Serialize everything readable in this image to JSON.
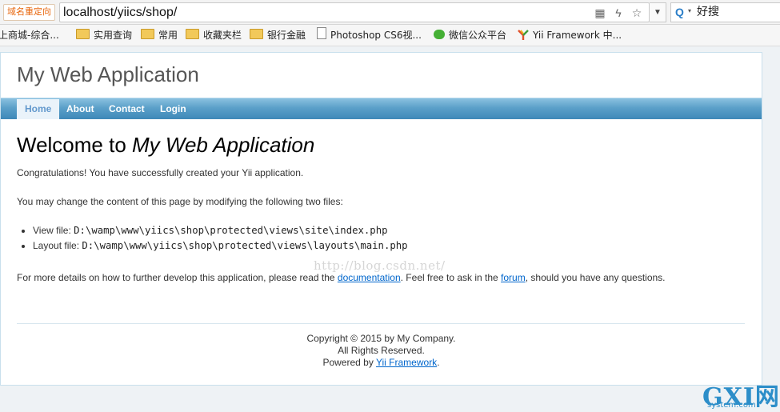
{
  "browser": {
    "redirect_label": "域名重定向",
    "url": "localhost/yiics/shop/",
    "search_text": "好搜",
    "bookmarks": [
      {
        "label": "上商城-综合...",
        "icon": "none"
      },
      {
        "label": "实用查询",
        "icon": "folder-icon"
      },
      {
        "label": "常用",
        "icon": "folder-icon"
      },
      {
        "label": "收藏夹栏",
        "icon": "folder-icon"
      },
      {
        "label": "银行金融",
        "icon": "folder-icon"
      },
      {
        "label": "Photoshop CS6视...",
        "icon": "page-icon"
      },
      {
        "label": "微信公众平台",
        "icon": "wechat-icon"
      },
      {
        "label": "Yii Framework 中...",
        "icon": "yii-icon"
      }
    ]
  },
  "app": {
    "name": "My Web Application",
    "menu": [
      {
        "label": "Home",
        "active": true
      },
      {
        "label": "About",
        "active": false
      },
      {
        "label": "Contact",
        "active": false
      },
      {
        "label": "Login",
        "active": false
      }
    ]
  },
  "content": {
    "welcome_prefix": "Welcome to ",
    "welcome_app": "My Web Application",
    "congrats": "Congratulations! You have successfully created your Yii application.",
    "change_text": "You may change the content of this page by modifying the following two files:",
    "files": [
      {
        "label": "View file: ",
        "path": "D:\\wamp\\www\\yiics\\shop\\protected\\views\\site\\index.php"
      },
      {
        "label": "Layout file: ",
        "path": "D:\\wamp\\www\\yiics\\shop\\protected\\views\\layouts\\main.php"
      }
    ],
    "details_1": "For more details on how to further develop this application, please read the ",
    "documentation_link": "documentation",
    "details_2": ". Feel free to ask in the ",
    "forum_link": "forum",
    "details_3": ", should you have any questions.",
    "watermark": "http://blog.csdn.net/"
  },
  "footer": {
    "copyright": "Copyright © 2015 by My Company.",
    "rights": "All Rights Reserved.",
    "powered_by": "Powered by ",
    "framework_link": "Yii Framework",
    "period": "."
  },
  "corner_logo": {
    "big": "GXI网",
    "small": "system.com"
  }
}
